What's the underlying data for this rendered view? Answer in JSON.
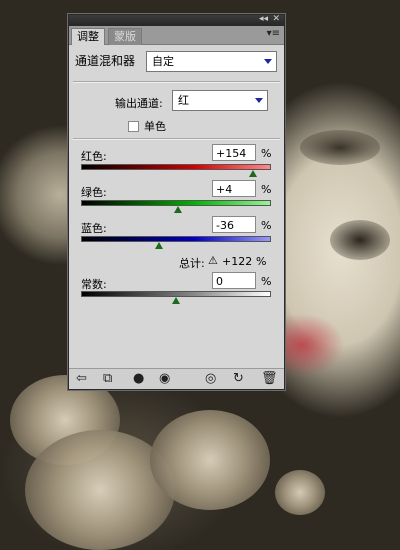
{
  "panel": {
    "tabs": [
      {
        "label": "调整",
        "active": true
      },
      {
        "label": "蒙版",
        "active": false
      }
    ],
    "title": "通道混和器",
    "preset_value": "自定",
    "output_channel_label": "输出通道:",
    "output_channel_value": "红",
    "monochrome_label": "单色",
    "monochrome_checked": false,
    "sliders": [
      {
        "label": "红色:",
        "value": "+154",
        "unit": "%",
        "fraction": 0.905,
        "color": "#d40000"
      },
      {
        "label": "绿色:",
        "value": "+4",
        "unit": "%",
        "fraction": 0.51,
        "color": "#00b400"
      },
      {
        "label": "蓝色:",
        "value": "-36",
        "unit": "%",
        "fraction": 0.41,
        "color": "#0000c8"
      }
    ],
    "total_label": "总计:",
    "total_value": "+122",
    "total_unit": "%",
    "constant": {
      "label": "常数:",
      "value": "0",
      "unit": "%",
      "fraction": 0.5
    }
  },
  "icons": {
    "titlebar": [
      "collapse-icon",
      "close-icon"
    ],
    "bottom": [
      "back-icon",
      "expand-view-icon",
      "clip-to-layer-icon",
      "visibility-eye-icon",
      "view-previous-icon",
      "reset-icon",
      "trash-icon"
    ]
  }
}
